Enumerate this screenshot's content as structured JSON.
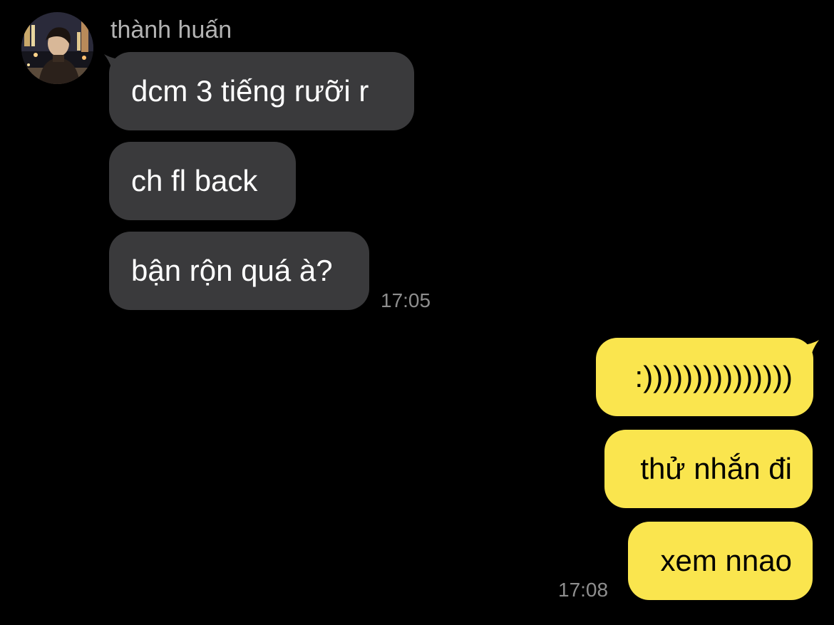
{
  "thread": {
    "sender_name": "thành huấn",
    "incoming_messages": [
      {
        "text": "dcm 3 tiếng rưỡi r"
      },
      {
        "text": "ch fl back"
      },
      {
        "text": "bận rộn quá à?"
      }
    ],
    "incoming_time": "17:05",
    "outgoing_messages": [
      {
        "text": ":)))))))))))))))"
      },
      {
        "text": "thử nhắn đi"
      },
      {
        "text": "xem nnao"
      }
    ],
    "outgoing_time": "17:08"
  },
  "colors": {
    "background": "#000000",
    "incoming_bubble": "#3a3a3c",
    "outgoing_bubble": "#fae54e",
    "timestamp_text": "#8e8e8e",
    "sender_name_text": "#b3b3b3"
  }
}
